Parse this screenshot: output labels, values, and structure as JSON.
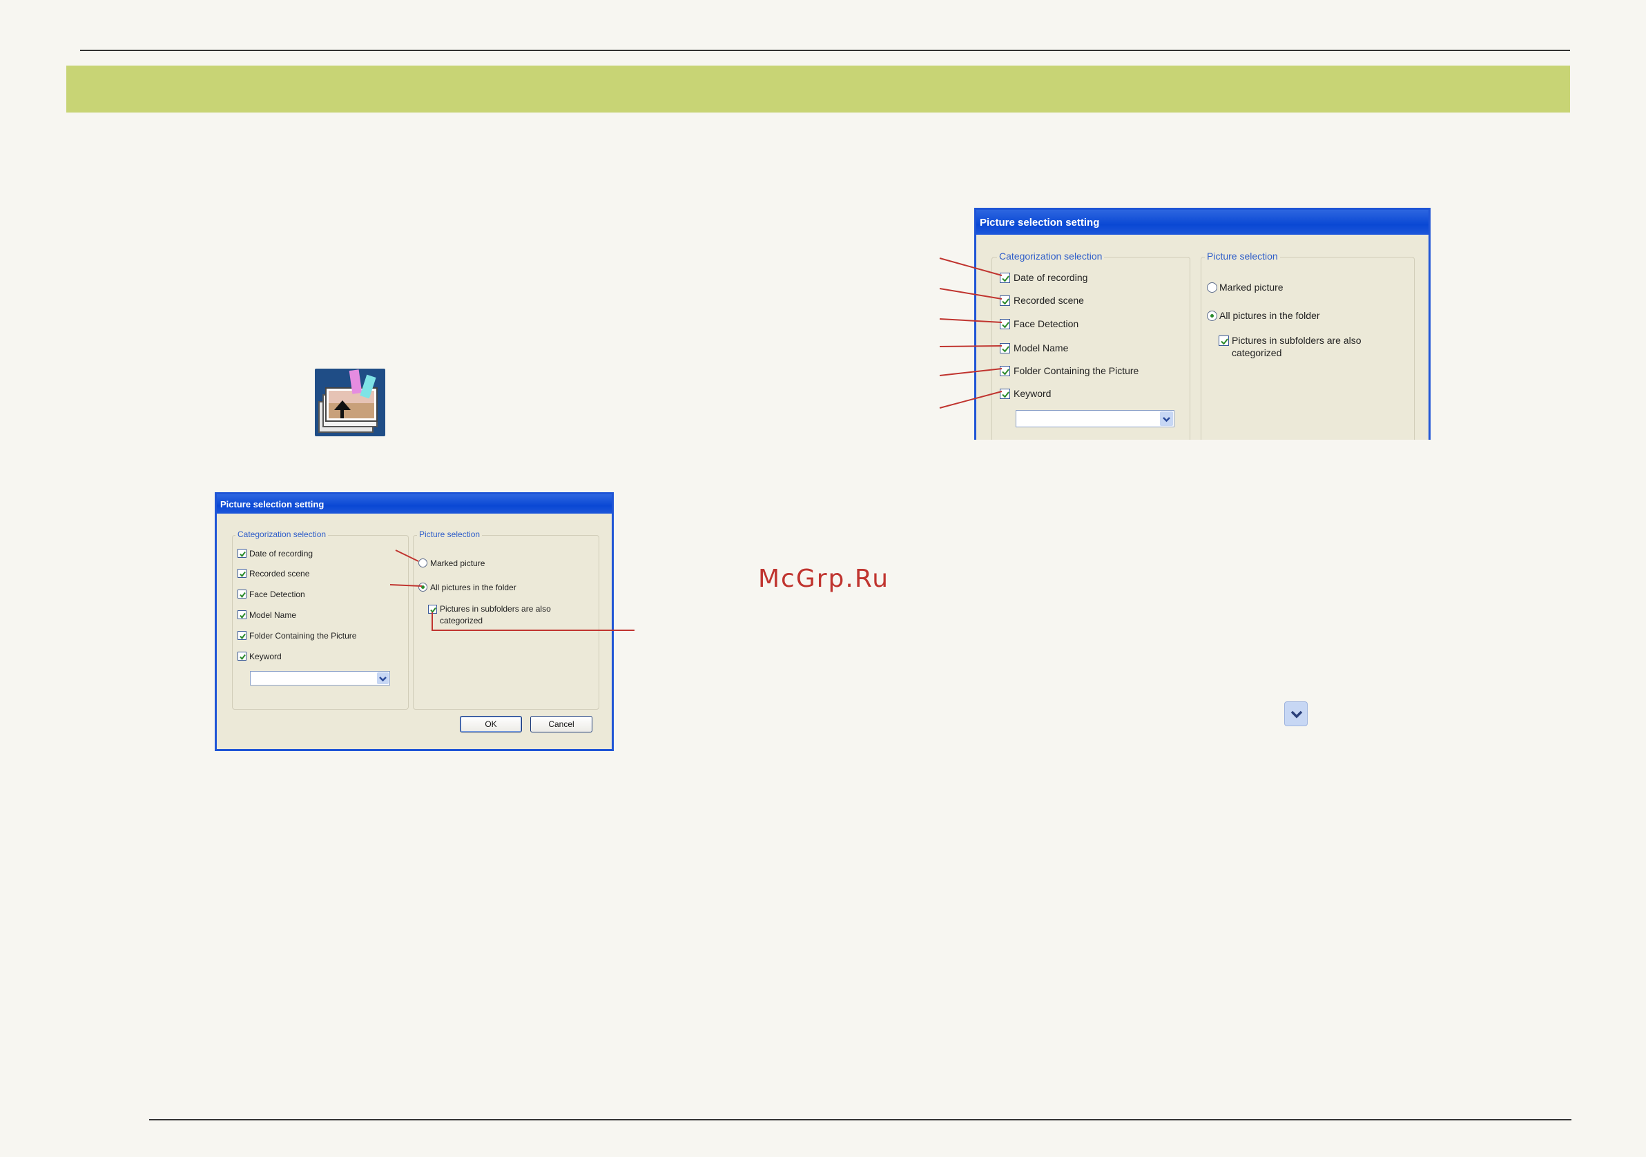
{
  "watermark": "McGrp.Ru",
  "dialog_small": {
    "title": "Picture selection setting",
    "categorization": {
      "label": "Categorization selection",
      "items": [
        "Date of recording",
        "Recorded scene",
        "Face Detection",
        "Model Name",
        "Folder Containing the Picture",
        "Keyword"
      ]
    },
    "picture": {
      "label": "Picture selection",
      "marked": "Marked picture",
      "all": "All pictures in the folder",
      "subfolders_line1": "Pictures in subfolders are also",
      "subfolders_line2": "categorized"
    },
    "ok": "OK",
    "cancel": "Cancel"
  },
  "dialog_large": {
    "title": "Picture selection setting",
    "categorization": {
      "label": "Categorization selection",
      "items": [
        "Date of recording",
        "Recorded scene",
        "Face Detection",
        "Model Name",
        "Folder Containing the Picture",
        "Keyword"
      ]
    },
    "picture": {
      "label": "Picture selection",
      "marked": "Marked picture",
      "all": "All pictures in the folder",
      "subfolders_line1": "Pictures in subfolders are also",
      "subfolders_line2": "categorized"
    }
  },
  "colors": {
    "banner": "#c8d475",
    "dialog_title": "#0a48d4",
    "leader_line": "#c0342f"
  },
  "icons": [
    "picture-stack-icon",
    "chevron-down-icon",
    "checkmark-icon"
  ]
}
